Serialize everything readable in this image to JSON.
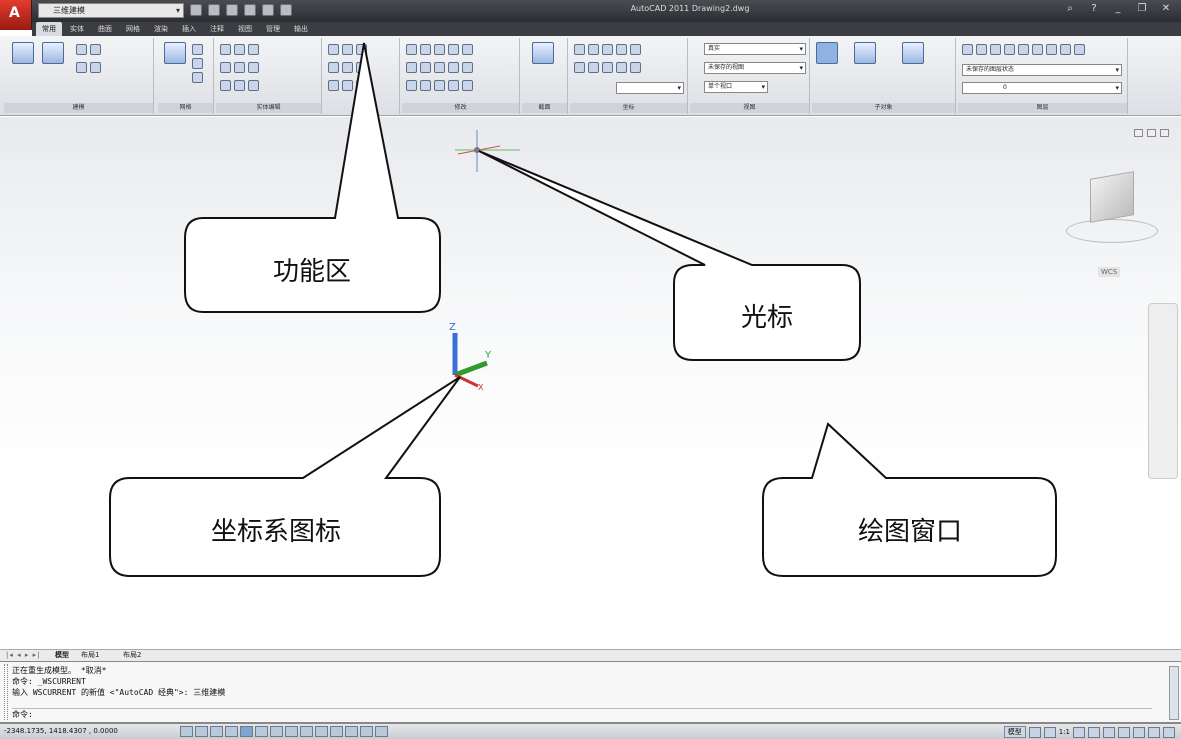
{
  "window": {
    "title": "AutoCAD 2011   Drawing2.dwg",
    "workspace": "三维建模"
  },
  "ribbon": {
    "tabs": [
      "常用",
      "实体",
      "曲面",
      "网格",
      "渲染",
      "插入",
      "注释",
      "视图",
      "管理",
      "输出"
    ],
    "active_tab": "常用",
    "panels": {
      "modeling_title": "建模",
      "mesh_title": "网格",
      "solid_edit_title": "实体编辑",
      "modify_title": "修改",
      "section_title": "截面",
      "coordinates_title": "坐标",
      "view_title": "视图",
      "subobject_title": "子对象",
      "layers_title": "图层"
    },
    "view_combos": {
      "visual_style": "真实",
      "camera": "未保存的视图",
      "viewport": "单个视口",
      "layer_state": "未保存的图层状态",
      "layer": "0"
    }
  },
  "callouts": {
    "ribbon": "功能区",
    "cursor": "光标",
    "ucs_icon": "坐标系图标",
    "drawing_window": "绘图窗口"
  },
  "ucs": {
    "z": "Z",
    "y": "Y",
    "x": "X"
  },
  "viewcube": {
    "wcs_label": "WCS"
  },
  "layout_tabs": [
    "模型",
    "布局1",
    "布局2"
  ],
  "command_line": {
    "history": [
      "正在重生成模型。 *取消*",
      "命令:  _WSCURRENT",
      "输入 WSCURRENT 的新值 <\"AutoCAD 经典\">: 三维建模"
    ],
    "prompt": "命令:"
  },
  "status": {
    "coordinates": "-2348.1735, 1418.4307 , 0.0000",
    "model_label": "模型",
    "annotation_scale": "1:1"
  }
}
